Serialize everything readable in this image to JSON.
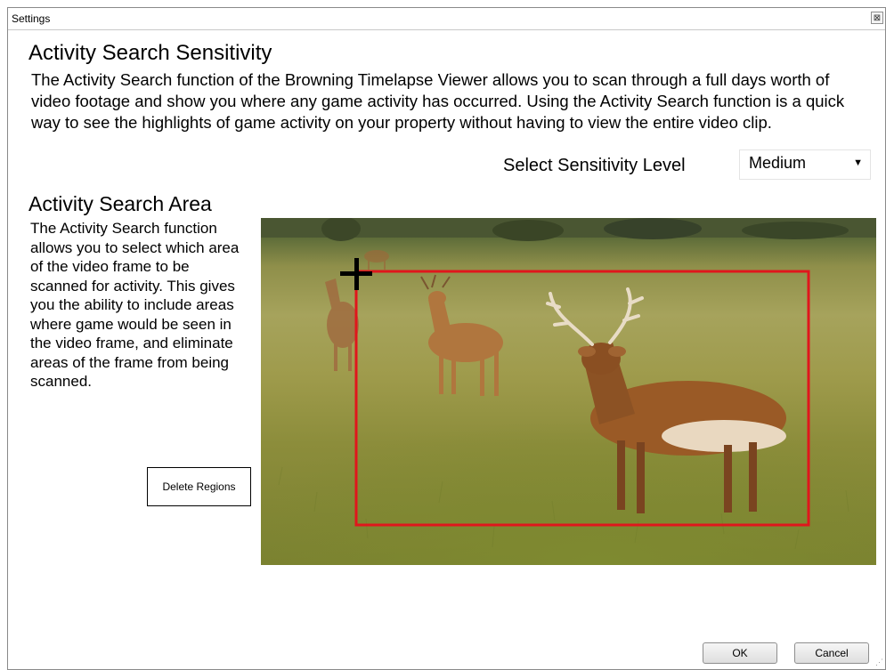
{
  "window": {
    "title": "Settings",
    "close_glyph": "⊠"
  },
  "sensitivity": {
    "heading": "Activity Search Sensitivity",
    "description": "The Activity Search function of the Browning Timelapse Viewer allows you to scan through a full days worth of video footage and show you where any game activity has occurred. Using the Activity Search function is a quick way to see the highlights of game activity on your property without having to view the entire video clip.",
    "select_label": "Select Sensitivity Level",
    "selected_value": "Medium"
  },
  "area": {
    "heading": "Activity Search Area",
    "description": "The Activity Search function allows you to select which area of the video frame to be scanned for activity. This gives you the ability to include areas where game would be seen in the video frame, and eliminate areas of the frame from being scanned.",
    "delete_button": "Delete Regions"
  },
  "footer": {
    "ok": "OK",
    "cancel": "Cancel"
  },
  "colors": {
    "region_outline": "#e0161c",
    "crosshair": "#000000"
  },
  "icons": {
    "dropdown": "chevron-down-icon",
    "close": "close-icon",
    "crosshair": "crosshair-icon"
  }
}
